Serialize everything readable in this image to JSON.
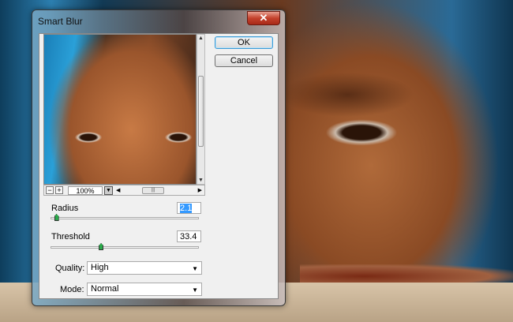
{
  "dialog": {
    "title": "Smart Blur",
    "close_icon": "close-icon"
  },
  "buttons": {
    "ok": "OK",
    "cancel": "Cancel"
  },
  "preview": {
    "zoom_level": "100%",
    "zoom_out": "−",
    "zoom_in": "+"
  },
  "radius": {
    "label": "Radius",
    "value": "2.1",
    "fraction": 0.02
  },
  "threshold": {
    "label": "Threshold",
    "value": "33.4",
    "fraction": 0.334
  },
  "quality": {
    "label": "Quality:",
    "value": "High"
  },
  "mode": {
    "label": "Mode:",
    "value": "Normal"
  }
}
